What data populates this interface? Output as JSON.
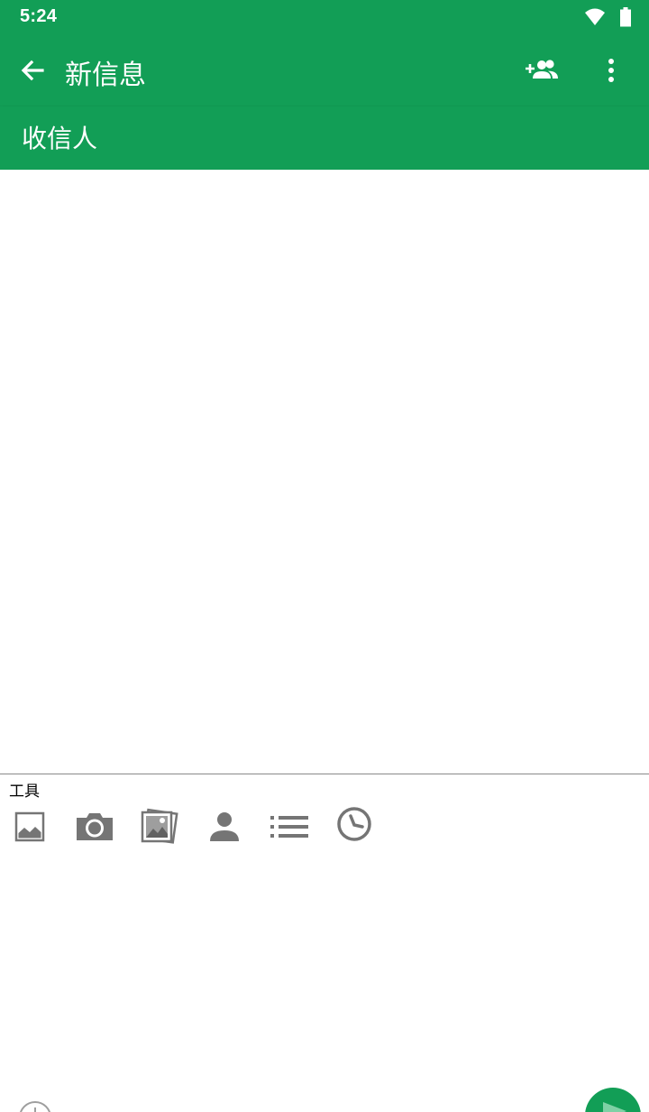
{
  "status_bar": {
    "time": "5:24",
    "icons": [
      "wifi-icon",
      "battery-icon"
    ]
  },
  "app_bar": {
    "title": "新信息",
    "back_icon": "arrow-back-icon",
    "actions": [
      "add-contact-icon",
      "more-vert-icon"
    ]
  },
  "recipient": {
    "placeholder": "收信人",
    "value": ""
  },
  "tools": {
    "label": "工具",
    "items": [
      {
        "icon": "image-icon"
      },
      {
        "icon": "camera-icon"
      },
      {
        "icon": "gallery-icon"
      },
      {
        "icon": "contact-icon"
      },
      {
        "icon": "list-icon"
      },
      {
        "icon": "schedule-icon"
      }
    ]
  },
  "compose": {
    "value": "",
    "placeholder": ""
  },
  "colors": {
    "primary": "#129e56",
    "icon_gray": "#757575",
    "white": "#ffffff"
  }
}
